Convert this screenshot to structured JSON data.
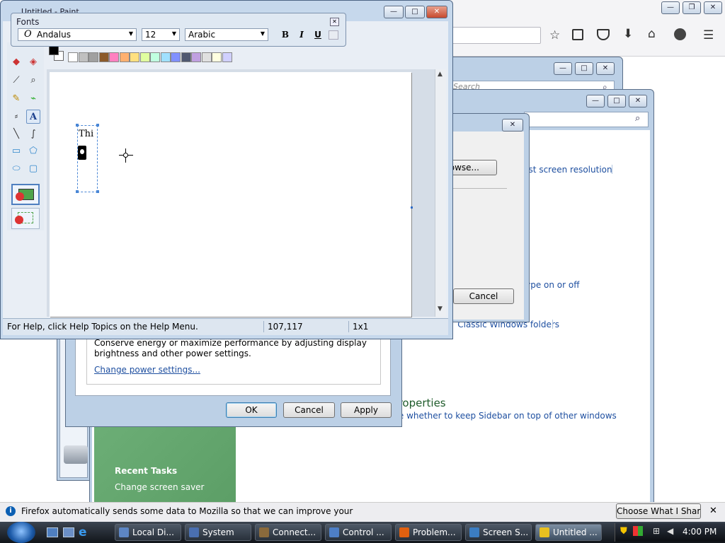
{
  "paint": {
    "title": "Untitled - Paint",
    "status_help": "For Help, click Help Topics on the Help Menu.",
    "status_coords": "107,117",
    "status_size": "1x1",
    "canvas_text": "Thi"
  },
  "fonts_toolbar": {
    "title": "Fonts",
    "font_name": "Andalus",
    "font_size": "12",
    "script": "Arabic",
    "bold": "B",
    "italic": "I",
    "underline": "U"
  },
  "palette": {
    "top": [
      "#000000",
      "#808080",
      "#800000",
      "#808000",
      "#008000",
      "#008080",
      "#000080",
      "#800080",
      "#808040",
      "#004040",
      "#0080ff",
      "#004080",
      "#8000ff",
      "#804000",
      "#c0c0c0",
      "#a0a0a4"
    ],
    "bottom": [
      "#ffffff",
      "#c0c0c0",
      "#a0a0a0",
      "#8b5a2b",
      "#ff80c0",
      "#ffb070",
      "#ffe080",
      "#e0ffa0",
      "#c0ffe0",
      "#a0e0ff",
      "#8090ff",
      "#505870",
      "#c0a0e0",
      "#e0e0e0",
      "#ffffe0",
      "#d0d0ff"
    ]
  },
  "firefox": {
    "search_placeholder": "Search",
    "notification": "Firefox automatically sends some data to Mozilla so that we can improve your experience.",
    "share_button": "Choose What I Share"
  },
  "control_panel": {
    "link_resolution": "Adjust screen resolution",
    "link_onoff": "Turn ClearType on or off",
    "link_classic": "Use Classic Windows folders",
    "sidebar_heading": "Windows Sidebar Properties",
    "sidebar_link": "Choose whether to keep Sidebar on top of other windows",
    "recent_tasks_title": "Recent Tasks",
    "recent_task_1": "Change screen saver"
  },
  "browse_dialog": {
    "browse_button": "Browse...",
    "cancel_button": "Cancel"
  },
  "power_dialog": {
    "description_1": "Conserve energy or maximize performance by adjusting display",
    "description_2": "brightness and other power settings.",
    "link": "Change power settings...",
    "ok": "OK",
    "cancel": "Cancel",
    "apply": "Apply"
  },
  "taskbar": {
    "items": [
      "Local Di...",
      "System",
      "Connect...",
      "Control ...",
      "Problem...",
      "Screen S...",
      "Untitled ..."
    ],
    "clock": "4:00 PM"
  }
}
